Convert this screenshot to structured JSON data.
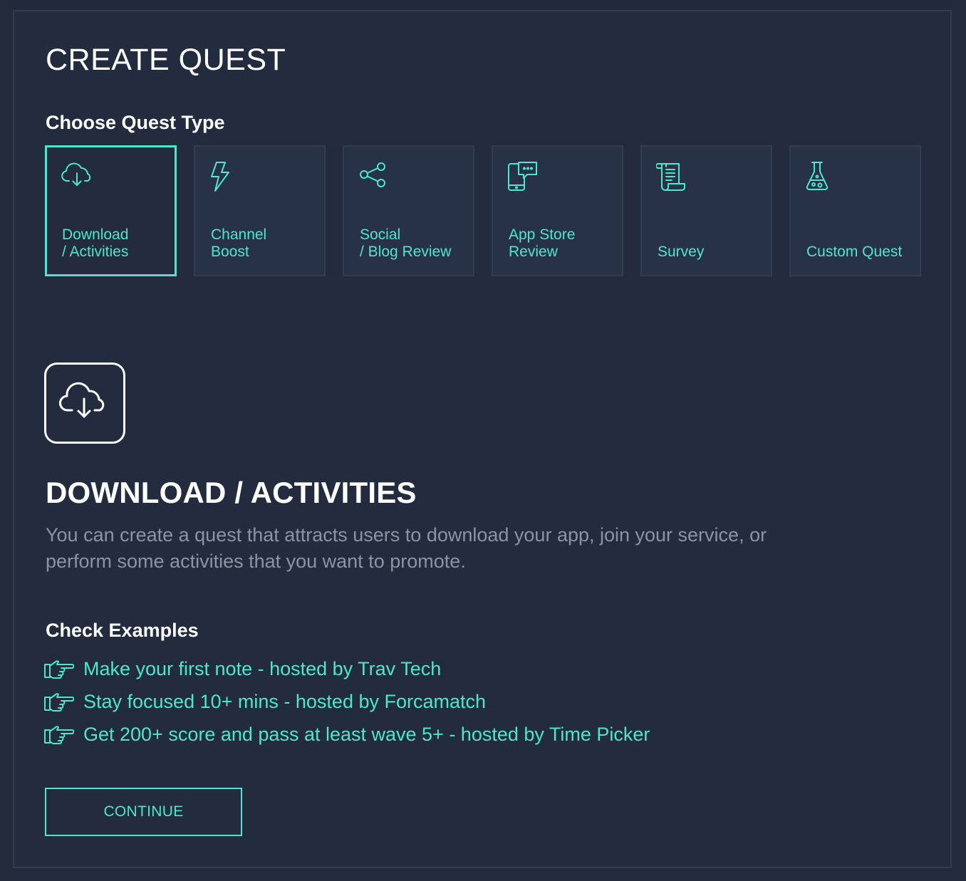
{
  "page": {
    "title": "CREATE QUEST",
    "choose_label": "Choose Quest Type"
  },
  "quest_types": [
    {
      "label": "Download\n/ Activities",
      "icon": "cloud-download-icon",
      "selected": true
    },
    {
      "label": "Channel\nBoost",
      "icon": "lightning-icon",
      "selected": false
    },
    {
      "label": "Social\n/ Blog Review",
      "icon": "share-icon",
      "selected": false
    },
    {
      "label": "App Store\nReview",
      "icon": "phone-chat-icon",
      "selected": false
    },
    {
      "label": "Survey",
      "icon": "scroll-icon",
      "selected": false
    },
    {
      "label": "Custom Quest",
      "icon": "flask-icon",
      "selected": false
    }
  ],
  "detail": {
    "icon": "cloud-download-icon",
    "title": "DOWNLOAD / ACTIVITIES",
    "description": "You can create a quest that attracts users to download your app, join your service, or perform some activities that you want to promote."
  },
  "examples": {
    "heading": "Check Examples",
    "icon": "pointing-hand-icon",
    "items": [
      "Make your first note - hosted by Trav Tech",
      "Stay focused 10+ mins - hosted by Forcamatch",
      "Get 200+ score and pass at least wave 5+ - hosted by Time Picker"
    ]
  },
  "actions": {
    "continue_label": "CONTINUE"
  },
  "colors": {
    "background": "#232c3e",
    "accent": "#4ee6d0",
    "card": "#283246",
    "muted_text": "#8c94a2"
  }
}
